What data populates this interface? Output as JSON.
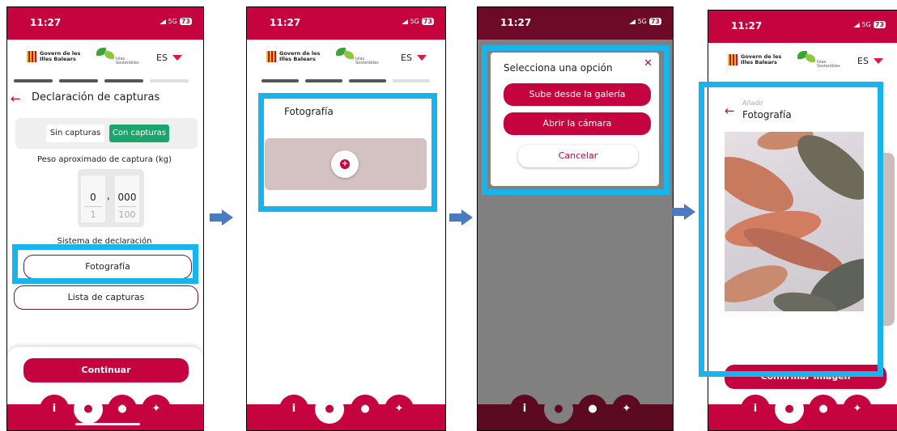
{
  "colors": {
    "brand": "#c5043f",
    "highlight": "#19b4ec",
    "arrow": "#4a7ac0",
    "active_toggle": "#1aa66a",
    "photo_placeholder": "#d4c2c2"
  },
  "status_bar": {
    "time": "11:27",
    "network": "5G",
    "battery": "73"
  },
  "header": {
    "govern_line1": "Govern de les",
    "govern_line2": "Illes Balears",
    "illes_line1": "Islas",
    "illes_line2": "Sostenibles",
    "language": "ES"
  },
  "icons": {
    "nav": [
      "info-icon",
      "fish-icon",
      "user-icon",
      "settings-icon"
    ],
    "back": "arrow-left-icon",
    "add": "plus-circle-icon",
    "close": "close-icon",
    "language_dropdown": "caret-down-icon",
    "flow": "arrow-right-icon"
  },
  "screen1": {
    "title": "Declaración de capturas",
    "toggle": {
      "options": [
        "Sin capturas",
        "Con capturas"
      ],
      "selected": "Con capturas"
    },
    "weight_label": "Peso aproximado de captura (kg)",
    "stepper": {
      "integer_value": "0",
      "integer_next": "1",
      "separator": ",",
      "decimal_value": "000",
      "decimal_next": "100"
    },
    "system_label": "Sistema de declaración",
    "options": [
      "Fotografía",
      "Lista de capturas"
    ],
    "continue_label": "Continuar",
    "progress_steps_complete": 3,
    "progress_steps_total": 4
  },
  "screen2": {
    "card_title": "Fotografía"
  },
  "screen3": {
    "dialog_title": "Selecciona una opción",
    "gallery_label": "Sube desde la galería",
    "camera_label": "Abrir la cámara",
    "cancel_label": "Cancelar"
  },
  "screen4": {
    "subtitle": "Añadir",
    "title": "Fotografía",
    "confirm_label": "Confirmar imagen",
    "close_glyph": "×"
  }
}
